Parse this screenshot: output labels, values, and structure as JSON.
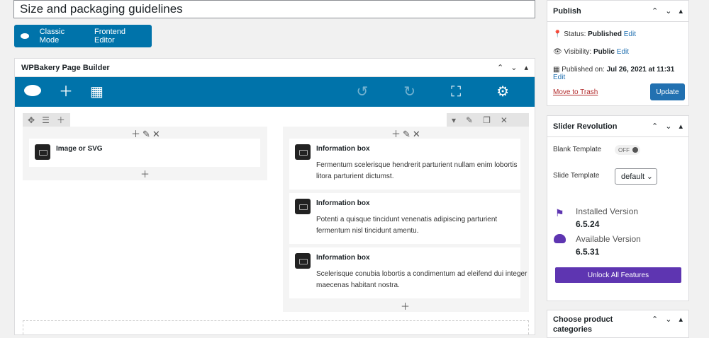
{
  "title_value": "Size and packaging guidelines",
  "mode": {
    "classic": "Classic Mode",
    "frontend": "Frontend Editor"
  },
  "wpb": {
    "title": "WPBakery Page Builder",
    "left_element": "Image or SVG",
    "info_title": "Information box",
    "info": [
      "Fermentum scelerisque hendrerit parturient nullam enim lobortis litora parturient dictumst.",
      "Potenti a quisque tincidunt venenatis adipiscing parturient fermentum nisl tincidunt amentu.",
      "Scelerisque conubia lobortis a condimentum ad eleifend dui integer maecenas habitant nostra."
    ]
  },
  "publish": {
    "title": "Publish",
    "status_label": "Status:",
    "status_value": "Published",
    "edit": "Edit",
    "visibility_label": "Visibility:",
    "visibility_value": "Public",
    "published_label": "Published on:",
    "published_value": "Jul 26, 2021 at 11:31",
    "trash": "Move to Trash",
    "update": "Update"
  },
  "slider": {
    "title": "Slider Revolution",
    "blank_template": "Blank Template",
    "toggle": "OFF",
    "slide_template": "Slide Template",
    "select_value": "default",
    "installed_label": "Installed Version",
    "installed_value": "6.5.24",
    "available_label": "Available Version",
    "available_value": "6.5.31",
    "unlock": "Unlock All Features"
  },
  "categories": {
    "title": "Choose product categories"
  }
}
